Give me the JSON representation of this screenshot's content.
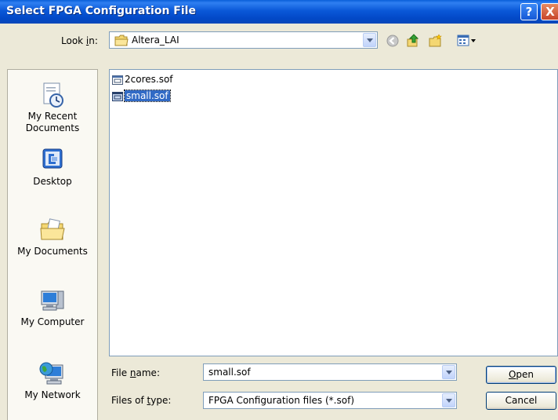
{
  "window": {
    "title": "Select FPGA Configuration File",
    "help_glyph": "?",
    "close_glyph": "X"
  },
  "lookin": {
    "label": "Look in:",
    "value": "Altera_LAI"
  },
  "toolbar": {
    "icons": [
      "back-icon",
      "up-folder-icon",
      "new-folder-icon",
      "views-menu-icon"
    ]
  },
  "places": [
    {
      "label": "My Recent Documents",
      "icon": "recent-documents-icon"
    },
    {
      "label": "Desktop",
      "icon": "desktop-icon"
    },
    {
      "label": "My Documents",
      "icon": "my-documents-icon"
    },
    {
      "label": "My Computer",
      "icon": "my-computer-icon"
    },
    {
      "label": "My Network",
      "icon": "my-network-icon"
    }
  ],
  "files": [
    {
      "name": "2cores.sof",
      "selected": false
    },
    {
      "name": "small.sof",
      "selected": true
    }
  ],
  "filename": {
    "label": "File name:",
    "value": "small.sof"
  },
  "filetype": {
    "label": "Files of type:",
    "value": "FPGA Configuration files (*.sof)"
  },
  "buttons": {
    "open": "Open",
    "cancel": "Cancel"
  },
  "colors": {
    "titlebar": "#0a58d8",
    "selection": "#316ac5",
    "dialog_bg": "#ece9d8"
  }
}
